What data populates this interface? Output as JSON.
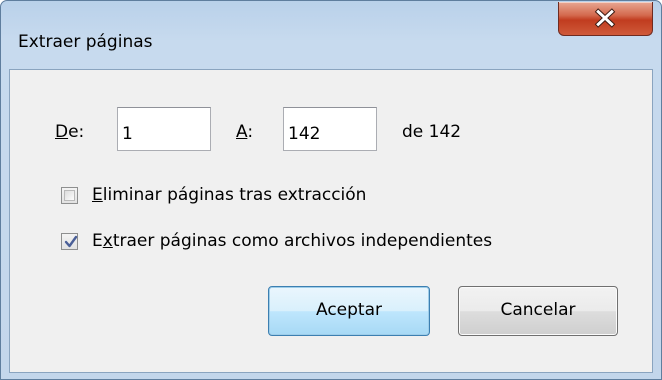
{
  "window": {
    "title": "Extraer páginas"
  },
  "range": {
    "from_label_prefix": "",
    "from_label_mnemonic": "D",
    "from_label_rest": "e:",
    "from_value": "1",
    "to_label_mnemonic": "A",
    "to_label_rest": ":",
    "to_value": "142",
    "total_text": "de 142"
  },
  "options": {
    "delete_mnemonic": "E",
    "delete_rest": "liminar páginas tras extracción",
    "delete_checked": false,
    "separate_prefix": "E",
    "separate_mnemonic": "x",
    "separate_rest": "traer páginas como archivos independientes",
    "separate_checked": true
  },
  "buttons": {
    "ok_label": "Aceptar",
    "cancel_label": "Cancelar"
  },
  "colors": {
    "frame": "#c3d6eb",
    "close_button": "#c13c1f",
    "default_button_border": "#3c7fb1",
    "check_mark": "#4a5f97"
  },
  "icons": {
    "close": "close-x-icon",
    "check": "checkmark-icon"
  }
}
